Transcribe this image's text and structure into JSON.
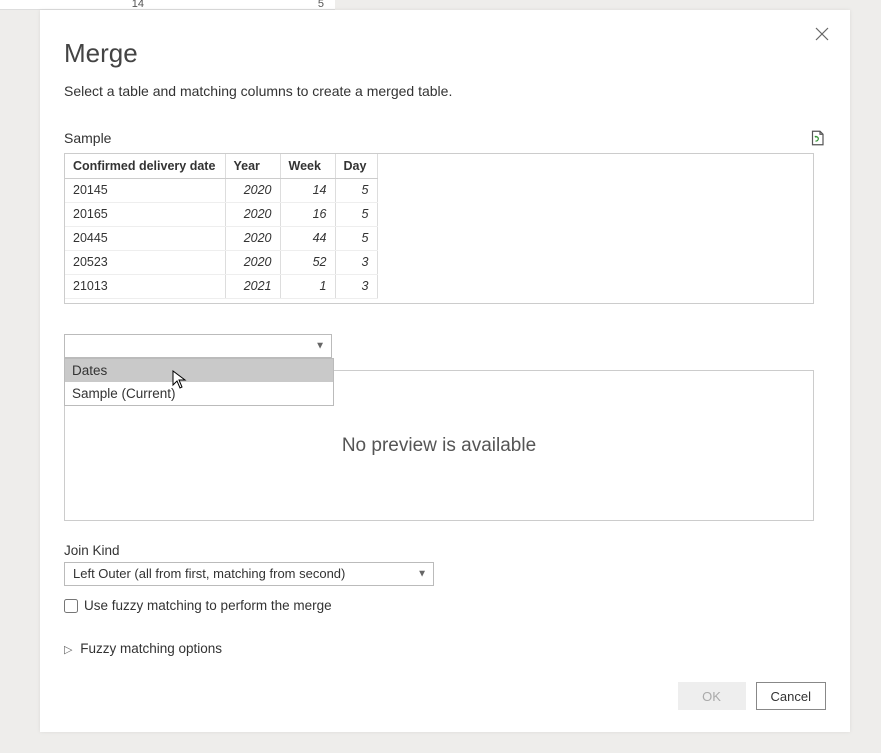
{
  "background": {
    "cell1": "14",
    "cell2": "5"
  },
  "dialog": {
    "title": "Merge",
    "subtitle": "Select a table and matching columns to create a merged table.",
    "first_table_label": "Sample",
    "columns": [
      "Confirmed delivery date",
      "Year",
      "Week",
      "Day"
    ],
    "rows": [
      {
        "cdd": "20145",
        "year": "2020",
        "week": "14",
        "day": "5"
      },
      {
        "cdd": "20165",
        "year": "2020",
        "week": "16",
        "day": "5"
      },
      {
        "cdd": "20445",
        "year": "2020",
        "week": "44",
        "day": "5"
      },
      {
        "cdd": "20523",
        "year": "2020",
        "week": "52",
        "day": "3"
      },
      {
        "cdd": "21013",
        "year": "2021",
        "week": "1",
        "day": "3"
      }
    ],
    "second_table_options": [
      "Dates",
      "Sample (Current)"
    ],
    "preview_text": "No preview is available",
    "join_kind_label": "Join Kind",
    "join_kind_value": "Left Outer (all from first, matching from second)",
    "fuzzy_checkbox_label": "Use fuzzy matching to perform the merge",
    "fuzzy_options_label": "Fuzzy matching options",
    "ok_label": "OK",
    "cancel_label": "Cancel"
  }
}
